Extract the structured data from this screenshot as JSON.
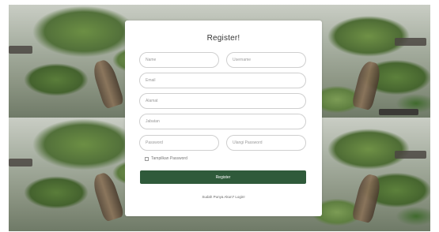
{
  "page": {
    "background_image": "bonsai-tree-garden",
    "accent_color": "#2f5a3a"
  },
  "form": {
    "title": "Register!",
    "fields": {
      "name": {
        "placeholder": "Name",
        "value": ""
      },
      "username": {
        "placeholder": "Username",
        "value": ""
      },
      "email": {
        "placeholder": "Email",
        "value": ""
      },
      "alamat": {
        "placeholder": "Alamat",
        "value": ""
      },
      "jabatan": {
        "placeholder": "Jabatan",
        "value": ""
      },
      "password": {
        "placeholder": "Password",
        "value": ""
      },
      "ulangi_password": {
        "placeholder": "Ulangi Password",
        "value": ""
      }
    },
    "show_password_label": "Tampilkan Password",
    "submit_label": "Register",
    "login_prompt": "Sudah Punya Akun? Login!"
  }
}
